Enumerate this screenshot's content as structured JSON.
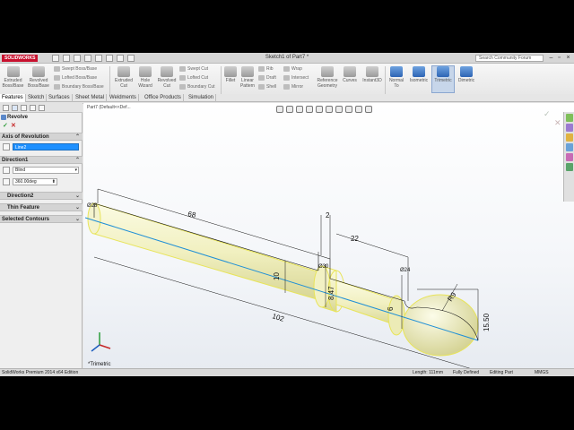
{
  "app": {
    "logo": "SOLIDWORKS",
    "window_title": "Sketch1 of Part7 *",
    "search_placeholder": "Search Community Forum"
  },
  "ribbon": {
    "extruded_boss": "Extruded Boss/Base",
    "revolved_boss": "Revolved Boss/Base",
    "swept_boss": "Swept Boss/Base",
    "lofted_boss": "Lofted Boss/Base",
    "boundary_boss": "Boundary Boss/Base",
    "extruded_cut": "Extruded Cut",
    "hole_wizard": "Hole Wizard",
    "revolved_cut": "Revolved Cut",
    "swept_cut": "Swept Cut",
    "lofted_cut": "Lofted Cut",
    "boundary_cut": "Boundary Cut",
    "fillet": "Fillet",
    "linear_pattern": "Linear Pattern",
    "rib": "Rib",
    "draft": "Draft",
    "shell": "Shell",
    "wrap": "Wrap",
    "intersect": "Intersect",
    "mirror": "Mirror",
    "reference_geometry": "Reference Geometry",
    "curves": "Curves",
    "instant3d": "Instant3D",
    "normal_to": "Normal To",
    "isometric": "Isometric",
    "trimetric": "Trimetric",
    "dimetric": "Dimetric"
  },
  "tabs": [
    "Features",
    "Sketch",
    "Surfaces",
    "Sheet Metal",
    "Weldments",
    "Office Products",
    "Simulation"
  ],
  "panel": {
    "title": "Revolve",
    "axis_section": "Axis of Revolution",
    "axis_value": "Line2",
    "direction1_section": "Direction1",
    "type_value": "Blind",
    "angle_value": "360.00deg",
    "direction2_section": "Direction2",
    "thin_feature_section": "Thin Feature",
    "selected_contours_section": "Selected Contours"
  },
  "viewport": {
    "breadcrumb": "Part7  (Default<<Def...",
    "view_label": "*Trimetric",
    "dimensions": {
      "d68": "68",
      "d2": "2",
      "d22": "22",
      "d10": "10",
      "d847": "8.47",
      "d6": "6",
      "d102": "102",
      "d1550": "15.50",
      "r9": "R9",
      "d28": "Ø28",
      "d30": "Ø30",
      "d24": "Ø24"
    }
  },
  "statusbar": {
    "edition": "SolidWorks Premium 2014 x64 Edition",
    "length": "Length: 111mm",
    "status": "Fully Defined",
    "mode": "Editing Part",
    "units": "MMGS"
  },
  "colors": {
    "part_fill": "#f3f2c4",
    "edge_highlight": "#e8e45a",
    "axis_line": "#1f8fd6",
    "selection_blue": "#1e90ff"
  }
}
